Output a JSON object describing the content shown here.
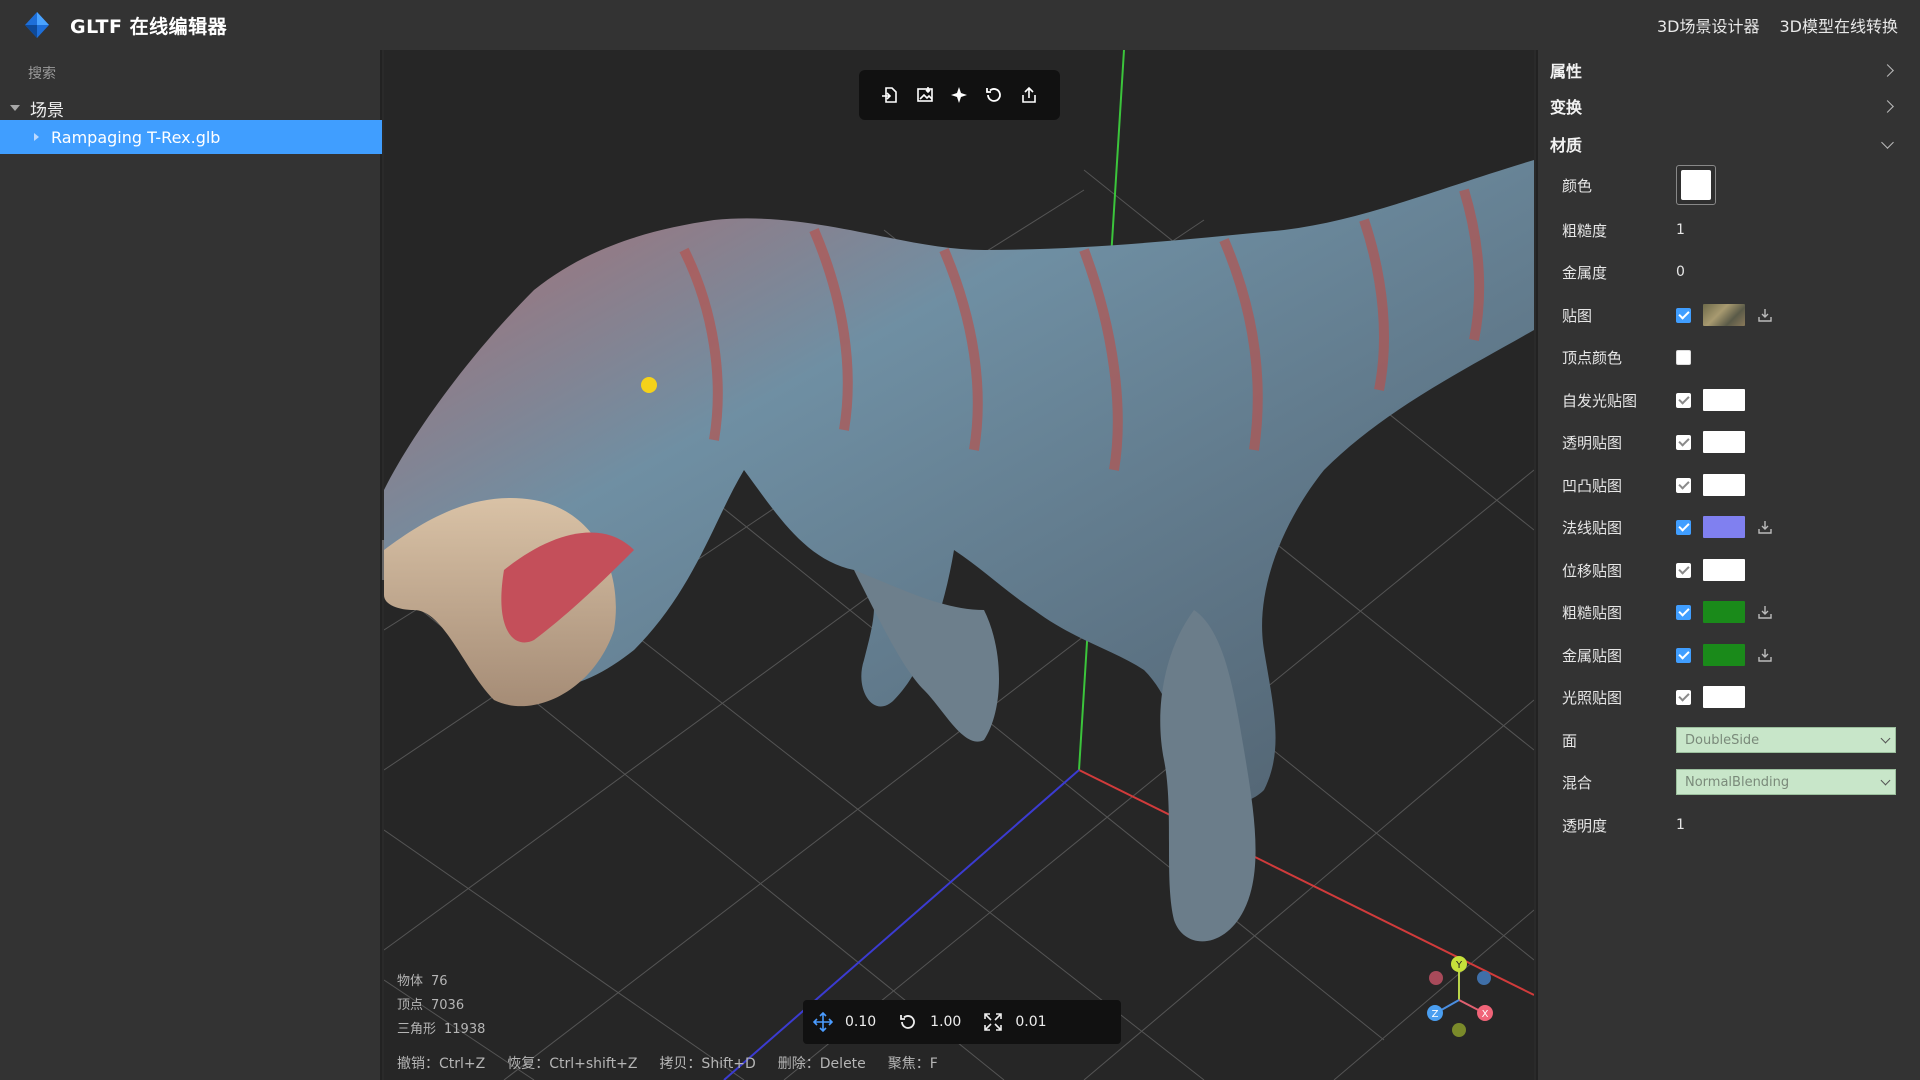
{
  "app": {
    "title": "GLTF 在线编辑器"
  },
  "top_links": [
    {
      "label": "3D场景设计器"
    },
    {
      "label": "3D模型在线转换"
    }
  ],
  "sidebar": {
    "search_placeholder": "搜索",
    "scene_label": "场景",
    "items": [
      {
        "label": "Rampaging T-Rex.glb"
      }
    ]
  },
  "viewport": {
    "toolbar": [
      {
        "icon": "import-icon"
      },
      {
        "icon": "export-image-icon"
      },
      {
        "icon": "light-icon"
      },
      {
        "icon": "reset-view-icon"
      },
      {
        "icon": "share-icon"
      }
    ],
    "stats": {
      "objects_label": "物体",
      "objects": "76",
      "vertices_label": "顶点",
      "vertices": "7036",
      "triangles_label": "三角形",
      "triangles": "11938"
    },
    "controls": {
      "translate": "0.10",
      "rotate": "1.00",
      "scale": "0.01"
    },
    "shortcuts": [
      "撤销：Ctrl+Z",
      "恢复：Ctrl+shift+Z",
      "拷贝：Shift+D",
      "删除：Delete",
      "聚焦：F"
    ],
    "axes": {
      "x": "X",
      "y": "Y",
      "z": "Z"
    }
  },
  "panel": {
    "sections": {
      "properties": "属性",
      "transform": "变换",
      "material": "材质"
    },
    "material": {
      "color_label": "颜色",
      "roughness_label": "粗糙度",
      "roughness": "1",
      "metalness_label": "金属度",
      "metalness": "0",
      "map_label": "贴图",
      "vertex_color_label": "顶点颜色",
      "emissive_map_label": "自发光贴图",
      "alpha_map_label": "透明贴图",
      "bump_map_label": "凹凸贴图",
      "normal_map_label": "法线贴图",
      "displacement_map_label": "位移贴图",
      "roughness_map_label": "粗糙贴图",
      "metalness_map_label": "金属贴图",
      "light_map_label": "光照贴图",
      "side_label": "面",
      "side": "DoubleSide",
      "blending_label": "混合",
      "blending": "NormalBlending",
      "opacity_label": "透明度",
      "opacity": "1"
    }
  },
  "colors": {
    "accent": "#409eff",
    "select_bg": "#c8e6c9",
    "normal_map": "#8080f0",
    "rough_map": "#1a8a1a"
  }
}
